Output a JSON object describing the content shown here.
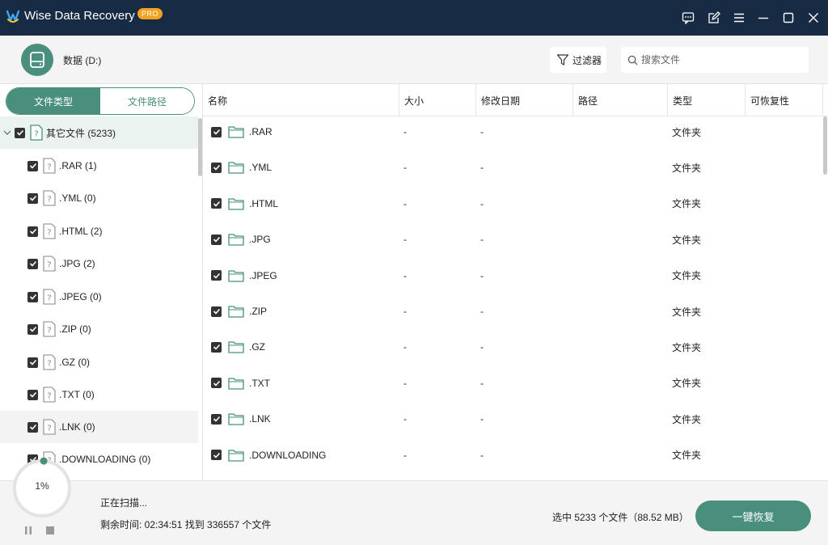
{
  "app": {
    "title": "Wise Data Recovery",
    "badge": "PRO",
    "accent_color": "#4a8f7d",
    "titlebar_color": "#172b45"
  },
  "window_controls": [
    "feedback-icon",
    "edit-icon",
    "menu-icon",
    "minimize-icon",
    "maximize-icon",
    "close-icon"
  ],
  "header": {
    "drive_label": "数据 (D:)",
    "filter_label": "过滤器",
    "search_placeholder": "搜索文件"
  },
  "left_pane": {
    "tabs": [
      {
        "label": "文件类型",
        "active": true
      },
      {
        "label": "文件路径",
        "active": false
      }
    ],
    "root": {
      "label": "其它文件 (5233)",
      "checked": true
    },
    "items": [
      {
        "label": ".RAR (1)",
        "checked": true
      },
      {
        "label": ".YML (0)",
        "checked": true
      },
      {
        "label": ".HTML (2)",
        "checked": true
      },
      {
        "label": ".JPG (2)",
        "checked": true
      },
      {
        "label": ".JPEG (0)",
        "checked": true
      },
      {
        "label": ".ZIP (0)",
        "checked": true
      },
      {
        "label": ".GZ (0)",
        "checked": true
      },
      {
        "label": ".TXT (0)",
        "checked": true
      },
      {
        "label": ".LNK (0)",
        "checked": true
      },
      {
        "label": ".DOWNLOADING (0)",
        "checked": true
      }
    ]
  },
  "table": {
    "columns": [
      "名称",
      "大小",
      "修改日期",
      "路径",
      "类型",
      "可恢复性"
    ],
    "rows": [
      {
        "name": ".RAR",
        "size": "-",
        "date": "-",
        "path": "",
        "type": "文件夹",
        "recoverability": ""
      },
      {
        "name": ".YML",
        "size": "-",
        "date": "-",
        "path": "",
        "type": "文件夹",
        "recoverability": ""
      },
      {
        "name": ".HTML",
        "size": "-",
        "date": "-",
        "path": "",
        "type": "文件夹",
        "recoverability": ""
      },
      {
        "name": ".JPG",
        "size": "-",
        "date": "-",
        "path": "",
        "type": "文件夹",
        "recoverability": ""
      },
      {
        "name": ".JPEG",
        "size": "-",
        "date": "-",
        "path": "",
        "type": "文件夹",
        "recoverability": ""
      },
      {
        "name": ".ZIP",
        "size": "-",
        "date": "-",
        "path": "",
        "type": "文件夹",
        "recoverability": ""
      },
      {
        "name": ".GZ",
        "size": "-",
        "date": "-",
        "path": "",
        "type": "文件夹",
        "recoverability": ""
      },
      {
        "name": ".TXT",
        "size": "-",
        "date": "-",
        "path": "",
        "type": "文件夹",
        "recoverability": ""
      },
      {
        "name": ".LNK",
        "size": "-",
        "date": "-",
        "path": "",
        "type": "文件夹",
        "recoverability": ""
      },
      {
        "name": ".DOWNLOADING",
        "size": "-",
        "date": "-",
        "path": "",
        "type": "文件夹",
        "recoverability": ""
      }
    ]
  },
  "footer": {
    "progress_percent": 1,
    "progress_label": "1%",
    "status": "正在扫描...",
    "detail": "剩余时间: 02:34:51 找到 336557 个文件",
    "selected_info": "选中 5233 个文件（88.52 MB）",
    "recover_label": "一键恢复"
  }
}
